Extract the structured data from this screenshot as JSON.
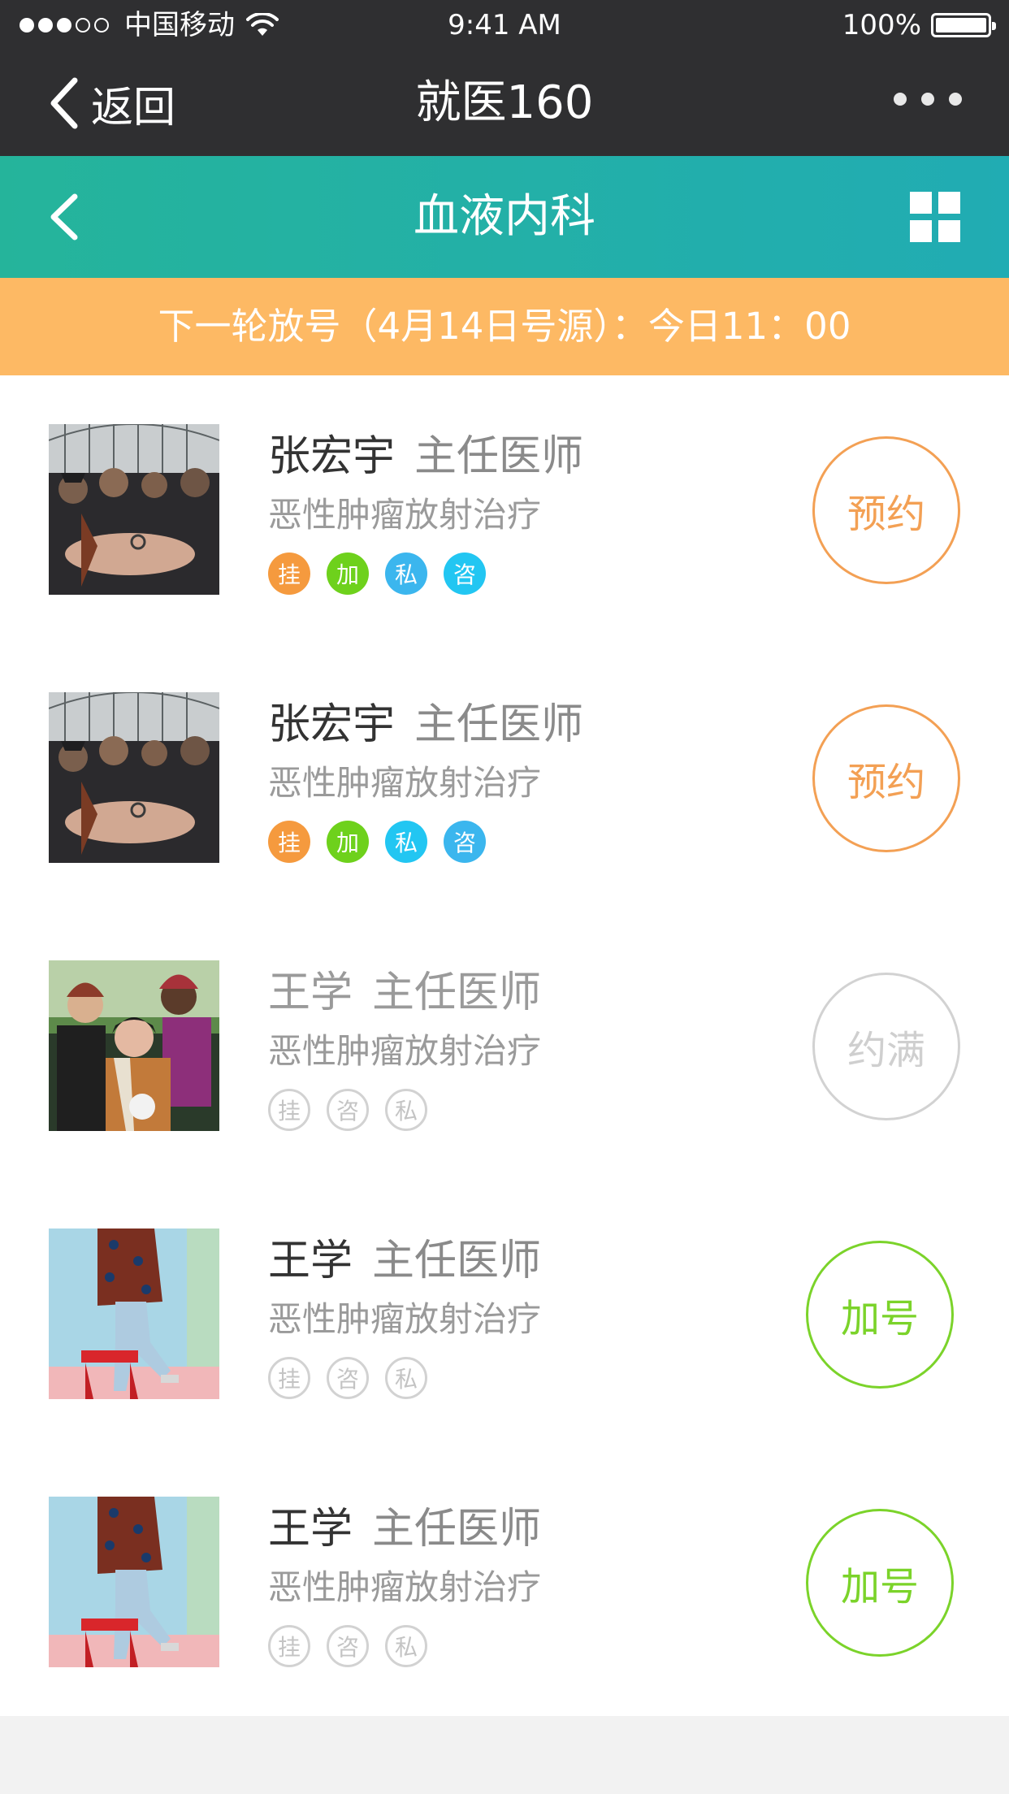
{
  "status_bar": {
    "carrier": "中国移动",
    "time": "9:41 AM",
    "battery": "100%",
    "signal_full": 3,
    "signal_total": 5,
    "battery_level": 1.0
  },
  "navbar": {
    "back_label": "返回",
    "title": "就医160",
    "more_icon": "more-dots-icon"
  },
  "page_header": {
    "title": "血液内科",
    "back_icon": "chevron-left-icon",
    "menu_icon": "grid-icon"
  },
  "notice": {
    "text": "下一轮放号（4月14日号源）：今日11：00"
  },
  "colors": {
    "tag_gua": "#f59a3e",
    "tag_jia": "#6ed11c",
    "tag_si": "#3bb6ee",
    "tag_zi": "#22c6f2",
    "action_orange": "#f3a054",
    "action_green": "#7bd32a",
    "action_gray": "#d2d2d2"
  },
  "doctors": [
    {
      "name": "张宏宇",
      "rank": "主任医师",
      "specialty": "恶性肿瘤放射治疗",
      "avatar": "band-photo-1",
      "tags": [
        {
          "label": "挂",
          "style": "filled",
          "color": "#f59a3e"
        },
        {
          "label": "加",
          "style": "filled",
          "color": "#6ed11c"
        },
        {
          "label": "私",
          "style": "filled",
          "color": "#3bb6ee"
        },
        {
          "label": "咨",
          "style": "filled",
          "color": "#22c6f2"
        }
      ],
      "action": {
        "label": "预约",
        "color": "#f3a054",
        "text_color": "#f3a054"
      }
    },
    {
      "name": "张宏宇",
      "rank": "主任医师",
      "specialty": "恶性肿瘤放射治疗",
      "avatar": "band-photo-1",
      "tags": [
        {
          "label": "挂",
          "style": "filled",
          "color": "#f59a3e"
        },
        {
          "label": "加",
          "style": "filled",
          "color": "#6ed11c"
        },
        {
          "label": "私",
          "style": "filled",
          "color": "#22c6f2"
        },
        {
          "label": "咨",
          "style": "filled",
          "color": "#3bb6ee"
        }
      ],
      "action": {
        "label": "预约",
        "color": "#f3a054",
        "text_color": "#f3a054"
      }
    },
    {
      "name": "王学",
      "rank": "主任医师",
      "specialty": "恶性肿瘤放射治疗",
      "avatar": "band-photo-2",
      "tags": [
        {
          "label": "挂",
          "style": "outline",
          "color": "#d2d2d2"
        },
        {
          "label": "咨",
          "style": "outline",
          "color": "#d2d2d2"
        },
        {
          "label": "私",
          "style": "outline",
          "color": "#d2d2d2"
        }
      ],
      "action": {
        "label": "约满",
        "color": "#d2d2d2",
        "text_color": "#cfcfcf"
      }
    },
    {
      "name": "王学",
      "rank": "主任医师",
      "specialty": "恶性肿瘤放射治疗",
      "avatar": "fashion-photo",
      "tags": [
        {
          "label": "挂",
          "style": "outline",
          "color": "#d2d2d2"
        },
        {
          "label": "咨",
          "style": "outline",
          "color": "#d2d2d2"
        },
        {
          "label": "私",
          "style": "outline",
          "color": "#d2d2d2"
        }
      ],
      "action": {
        "label": "加号",
        "color": "#7bd32a",
        "text_color": "#7bd32a"
      }
    },
    {
      "name": "王学",
      "rank": "主任医师",
      "specialty": "恶性肿瘤放射治疗",
      "avatar": "fashion-photo",
      "tags": [
        {
          "label": "挂",
          "style": "outline",
          "color": "#d2d2d2"
        },
        {
          "label": "咨",
          "style": "outline",
          "color": "#d2d2d2"
        },
        {
          "label": "私",
          "style": "outline",
          "color": "#d2d2d2"
        }
      ],
      "action": {
        "label": "加号",
        "color": "#7bd32a",
        "text_color": "#7bd32a"
      }
    }
  ]
}
